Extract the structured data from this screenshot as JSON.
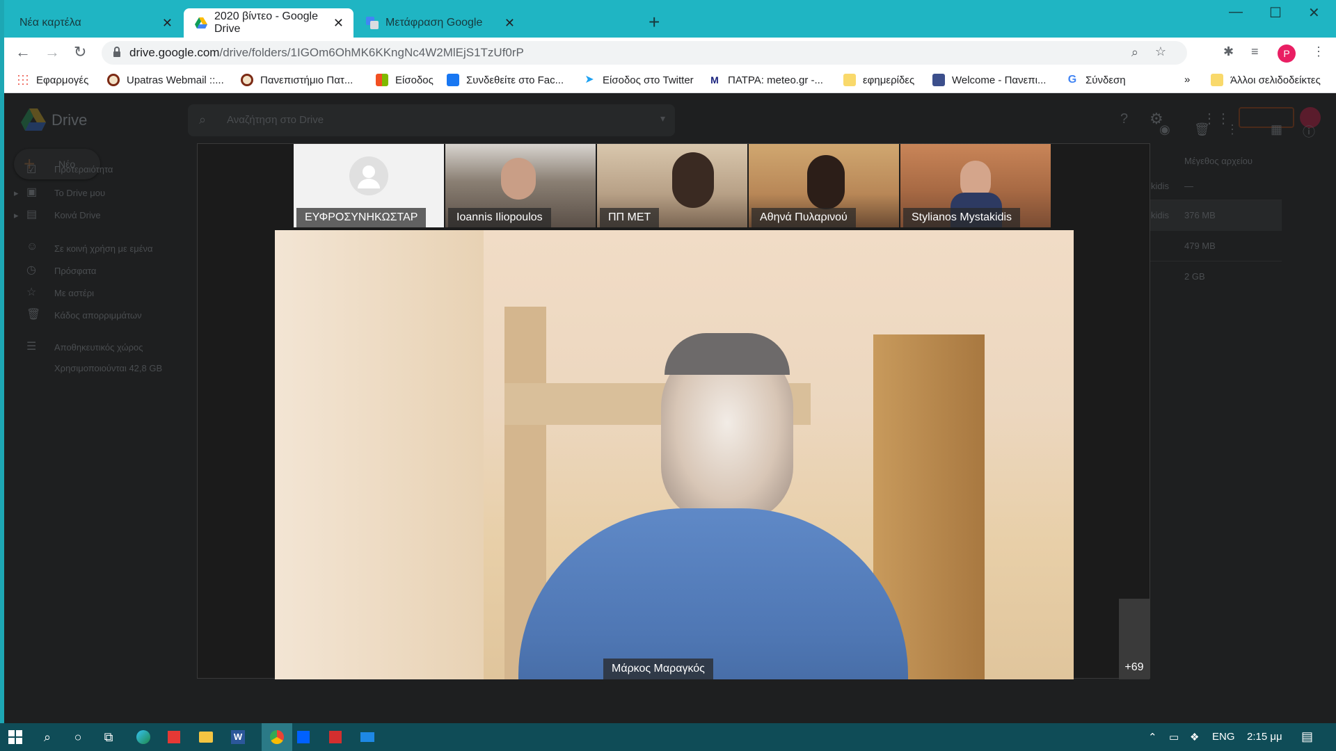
{
  "tabs": [
    {
      "title": "Νέα καρτέλα"
    },
    {
      "title": "2020 βίντεο - Google Drive"
    },
    {
      "title": "Μετάφραση Google"
    }
  ],
  "address": {
    "host": "drive.google.com",
    "path": "/drive/folders/1IGOm6OhMK6KKngNc4W2MlEjS1TzUf0rP"
  },
  "profile_initial": "P",
  "bookmarks": [
    {
      "label": "Εφαρμογές",
      "icon": "apps-grid-icon"
    },
    {
      "label": "Upatras Webmail ::...",
      "icon": "upatras-icon"
    },
    {
      "label": "Πανεπιστήμιο Πατ...",
      "icon": "upatras-icon"
    },
    {
      "label": "Είσοδος",
      "icon": "microsoft-icon"
    },
    {
      "label": "Συνδεθείτε στο Fac...",
      "icon": "facebook-icon"
    },
    {
      "label": "Είσοδος στο Twitter",
      "icon": "twitter-icon"
    },
    {
      "label": "ΠΑΤΡΑ: meteo.gr -...",
      "icon": "meteo-icon"
    },
    {
      "label": "εφημερίδες",
      "icon": "folder-icon"
    },
    {
      "label": "Welcome - Πανεπι...",
      "icon": "site-icon"
    },
    {
      "label": "Σύνδεση",
      "icon": "google-icon"
    },
    {
      "label": "»",
      "icon": ""
    },
    {
      "label": "Άλλοι σελιδοδείκτες",
      "icon": "folder-icon"
    }
  ],
  "drive": {
    "logo_text": "Drive",
    "search_placeholder": "Αναζήτηση στο Drive",
    "new_label": "Νέο",
    "nav": [
      {
        "label": "Προτεραιότητα"
      },
      {
        "label": "Το Drive μου"
      },
      {
        "label": "Κοινά Drive"
      },
      {
        "label": "Σε κοινή χρήση με εμένα"
      },
      {
        "label": "Πρόσφατα"
      },
      {
        "label": "Με αστέρι"
      },
      {
        "label": "Κάδος απορριμμάτων"
      },
      {
        "label": "Αποθηκευτικός χώρος"
      }
    ],
    "storage_used": "Χρησιμοποιούνται 42,8 GB",
    "column_header": "Μέγεθος αρχείου",
    "rows": [
      {
        "owner": "kidis",
        "size": "—"
      },
      {
        "owner": "kidis",
        "size": "376 MB"
      },
      {
        "owner": "",
        "size": "479 MB"
      },
      {
        "owner": "",
        "size": "2 GB"
      }
    ]
  },
  "meet": {
    "participants": [
      {
        "name": "ΕΥΦΡΟΣΥΝΗΚΩΣΤΑΡ"
      },
      {
        "name": "Ioannis Iliopoulos"
      },
      {
        "name": "ΠΠ ΜΕΤ"
      },
      {
        "name": "Αθηνά Πυλαρινού"
      },
      {
        "name": "Stylianos Mystakidis"
      }
    ],
    "speaker": "Μάρκος Μαραγκός",
    "more_count": "+69"
  },
  "tray": {
    "lang": "ENG",
    "time": "2:15 μμ"
  }
}
